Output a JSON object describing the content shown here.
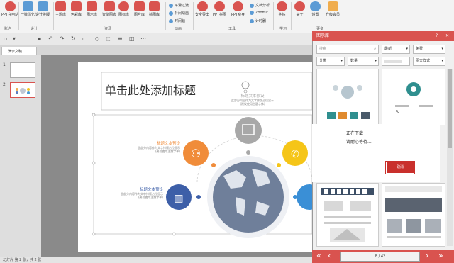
{
  "ribbon": {
    "buttons": [
      {
        "label": "PPT充电站",
        "icon": "ppt-station-icon",
        "color": "#d9534f"
      },
      {
        "label": "一键优化",
        "icon": "optimize-icon",
        "color": "#5b9bd5"
      },
      {
        "label": "设计排版",
        "icon": "layout-icon",
        "color": "#5b9bd5"
      },
      {
        "label": "主题库",
        "icon": "theme-icon",
        "color": "#d9534f"
      },
      {
        "label": "色彩库",
        "icon": "color-icon",
        "color": "#d9534f"
      },
      {
        "label": "图示库",
        "icon": "diagram-icon",
        "color": "#d9534f"
      },
      {
        "label": "智能图表",
        "icon": "chart-icon",
        "color": "#d9534f"
      },
      {
        "label": "图标库",
        "icon": "icon-lib-icon",
        "color": "#d9534f"
      },
      {
        "label": "图片库",
        "icon": "picture-icon",
        "color": "#d9534f"
      },
      {
        "label": "插图库",
        "icon": "illustration-icon",
        "color": "#d9534f"
      },
      {
        "label": "安全导出",
        "icon": "export-icon",
        "color": "#d9534f"
      },
      {
        "label": "PPT拼图",
        "icon": "collage-icon",
        "color": "#d9534f"
      },
      {
        "label": "PPT瘦身",
        "icon": "slim-icon",
        "color": "#d9534f"
      },
      {
        "label": "字帖",
        "icon": "copybook-icon",
        "color": "#d9534f"
      },
      {
        "label": "关于",
        "icon": "about-icon",
        "color": "#d9534f"
      },
      {
        "label": "设置",
        "icon": "settings-icon",
        "color": "#5b9bd5"
      },
      {
        "label": "升级会员",
        "icon": "upgrade-icon",
        "color": "#f0ad4e"
      }
    ],
    "small_items": [
      "平滑过渡",
      "补间动画",
      "时间轴",
      "文档分析",
      "ZoomIt",
      "计时器"
    ],
    "groups": [
      "账户",
      "设计",
      "资源",
      "动画",
      "工具",
      "学习",
      "更多"
    ]
  },
  "tab": {
    "name": "演示文稿1"
  },
  "thumbnails": [
    "1",
    "2"
  ],
  "slide": {
    "title": "单击此处添加标题",
    "blocks": [
      {
        "heading": "标题文本预设",
        "body": "此部分内容作为文字排版占位显示\n(建议使用主题字体)"
      },
      {
        "heading": "标题文本预设",
        "body": "此部分内容作为文字排版占位显示\n(建议使用主题字体)"
      },
      {
        "heading": "标题文本预设",
        "body": "此部分内容作为文字排版占位显示\n(建议使用主题字体)"
      }
    ]
  },
  "panel": {
    "title": "图示库",
    "help": "?",
    "close": "✕",
    "search_placeholder": "搜索",
    "sort_value": "最新",
    "paid_value": "免费",
    "category_value": "分类",
    "count_value": "数量",
    "style_value": "图文样式",
    "loading_line1": "正在下载",
    "loading_line2": "请耐心等待...",
    "cancel_label": "取消",
    "page_text": "8 / 42",
    "first": "«",
    "prev": "‹",
    "next": "›",
    "last": "»"
  },
  "status": {
    "text": "幻灯片 第 2 张，共 2 张"
  }
}
